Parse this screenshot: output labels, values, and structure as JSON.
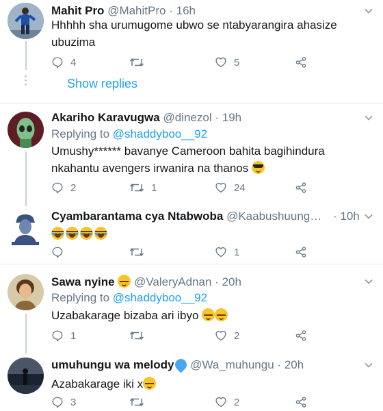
{
  "tweets": [
    {
      "name": "Mahit Pro",
      "handle": "@MahitPro",
      "time": "16h",
      "text": "Hhhhh sha urumugome ubwo se ntabyarangira ahasize ubuzima",
      "replies": "4",
      "retweets": "",
      "likes": "5",
      "show_replies": "Show replies"
    },
    {
      "name": "Akariho Karavugwa",
      "handle": "@dinezol",
      "time": "19h",
      "replying_prefix": "Replying to",
      "replying_to": "@shaddyboo__92",
      "text": "Umushy****** bavanye Cameroon  bahita bagihindura nkahantu avengers irwanira na thanos",
      "replies": "2",
      "retweets": "1",
      "likes": "24"
    },
    {
      "name": "Cyambarantama cya Ntabwoba",
      "handle": "@Kaabushuung…",
      "time": "10h",
      "text": "",
      "replies": "",
      "retweets": "",
      "likes": "1"
    },
    {
      "name": "Sawa nyine",
      "handle": "@ValeryAdnan",
      "time": "20h",
      "replying_prefix": "Replying to",
      "replying_to": "@shaddyboo__92",
      "text": "Uzabakarage bizaba ari ibyo",
      "replies": "1",
      "retweets": "",
      "likes": "2"
    },
    {
      "name": "umuhungu wa melody",
      "handle": "@Wa_muhungu",
      "time": "20h",
      "text": "Azabakarage iki x",
      "replies": "3",
      "retweets": "",
      "likes": "2"
    }
  ],
  "separator": "·",
  "icons": [
    "reply-icon",
    "retweet-icon",
    "like-icon",
    "share-icon",
    "caret-down-icon"
  ],
  "colors": {
    "link": "#1da1f2",
    "muted": "#657786",
    "text": "#14171a",
    "divider": "#e1e8ed"
  }
}
